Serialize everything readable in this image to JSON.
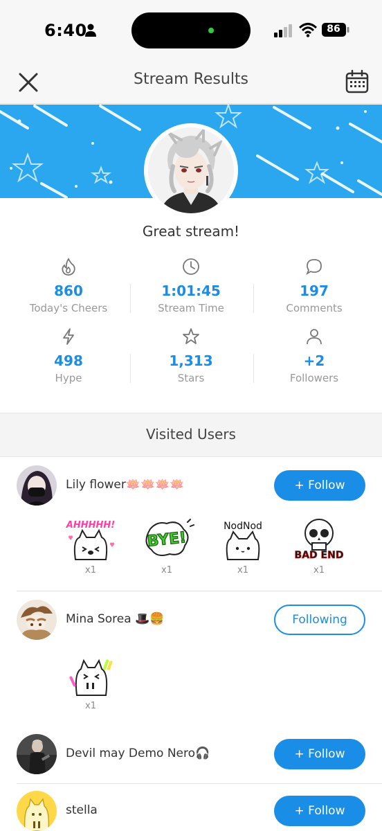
{
  "status_bar": {
    "time": "6:40",
    "battery": "86"
  },
  "header": {
    "title": "Stream Results"
  },
  "summary": {
    "message": "Great stream!"
  },
  "stats": [
    {
      "value": "860",
      "label": "Today's Cheers",
      "icon": "flame-icon"
    },
    {
      "value": "1:01:45",
      "label": "Stream Time",
      "icon": "clock-icon"
    },
    {
      "value": "197",
      "label": "Comments",
      "icon": "comment-icon"
    },
    {
      "value": "498",
      "label": "Hype",
      "icon": "lightning-icon"
    },
    {
      "value": "1,313",
      "label": "Stars",
      "icon": "star-icon"
    },
    {
      "value": "+2",
      "label": "Followers",
      "icon": "person-icon"
    }
  ],
  "visited": {
    "title": "Visited Users",
    "users": [
      {
        "name": "Lily flower🪷🪷🪷🪷",
        "button": "+ Follow",
        "stickers": [
          {
            "caption": "AHHHHH!",
            "count": "x1"
          },
          {
            "caption": "BYE!",
            "count": "x1"
          },
          {
            "caption": "NodNod",
            "count": "x1"
          },
          {
            "caption": "BAD END",
            "count": "x1"
          }
        ]
      },
      {
        "name": "Mina Sorea 🎩🍔",
        "button": "Following",
        "stickers": [
          {
            "caption": "",
            "count": "x1"
          }
        ]
      },
      {
        "name": "Devil may Demo Nero🎧",
        "button": "+ Follow"
      },
      {
        "name": "stella",
        "button": "+ Follow"
      }
    ]
  },
  "colors": {
    "accent": "#1a8de6",
    "banner": "#2aa7ee",
    "muted": "#999999"
  }
}
